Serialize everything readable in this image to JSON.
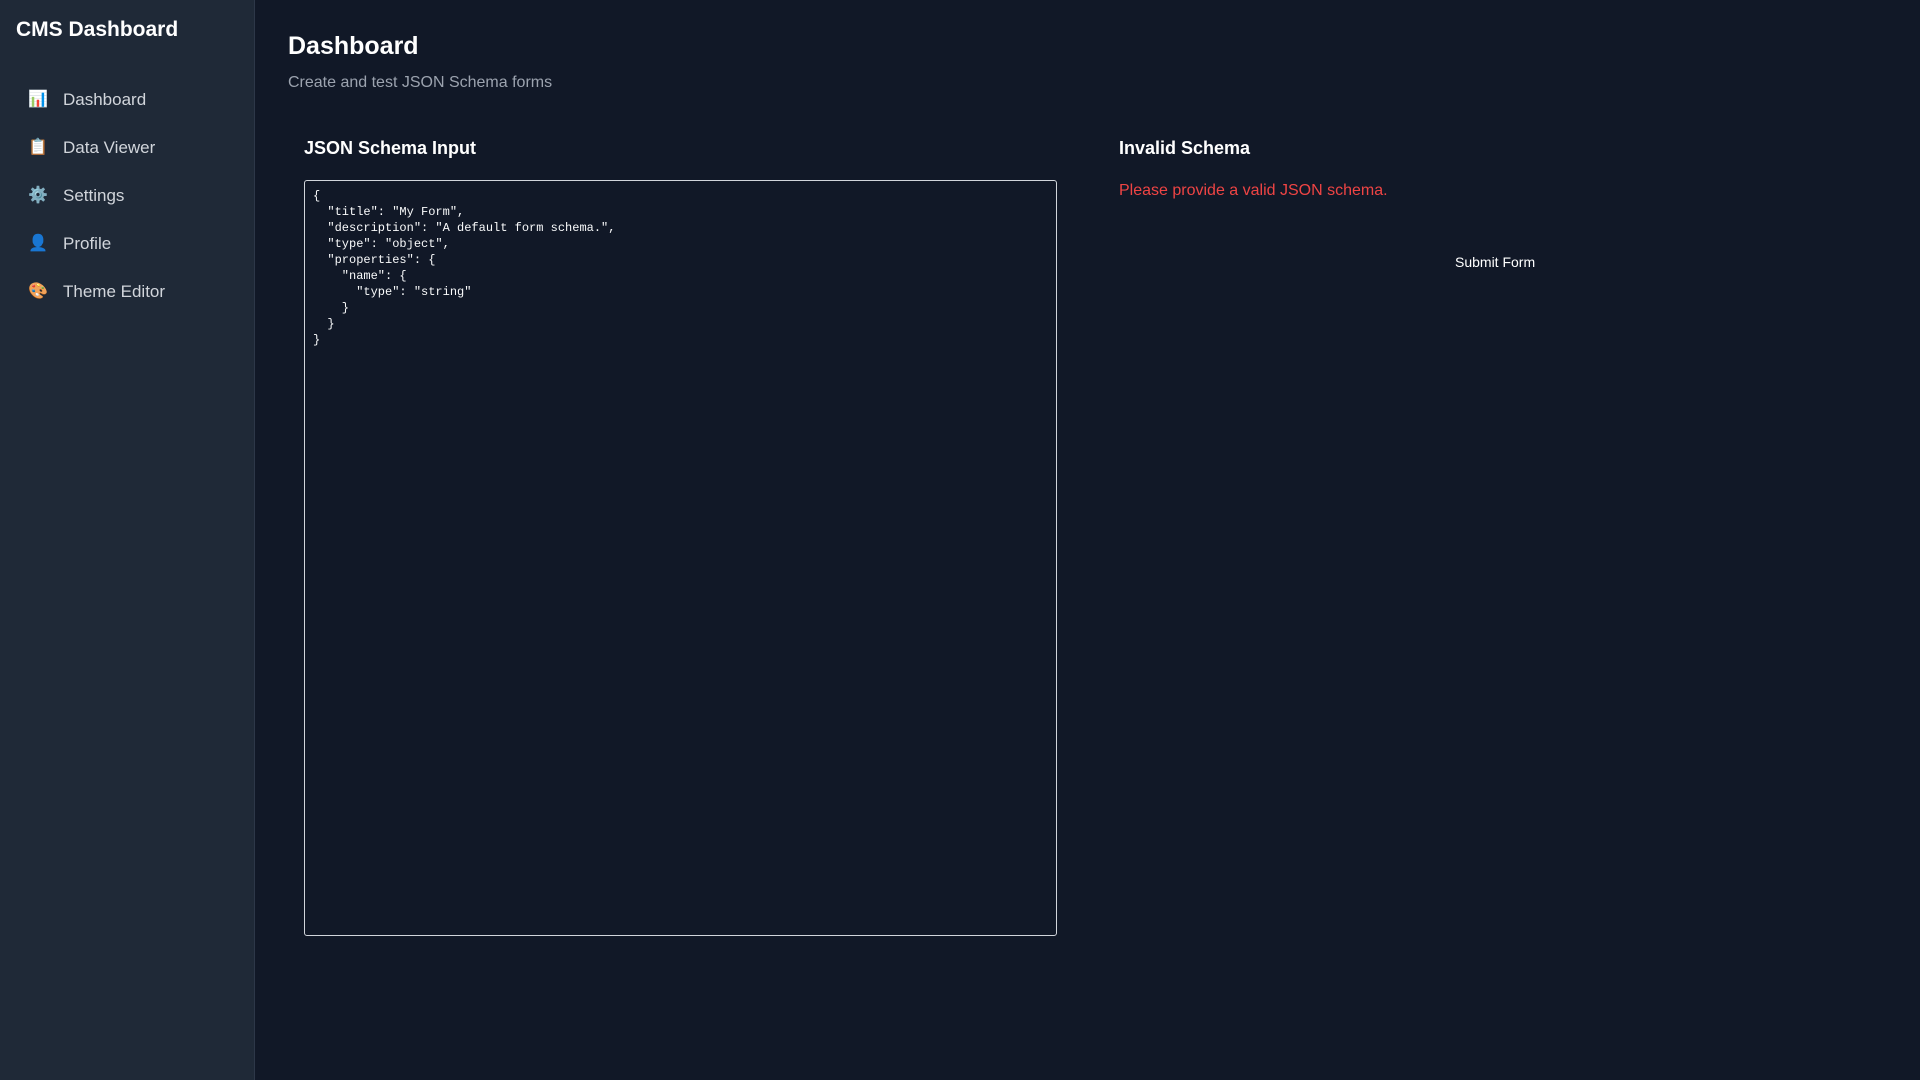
{
  "sidebar": {
    "brand": "CMS Dashboard",
    "items": [
      {
        "label": "Dashboard",
        "icon": "chart-icon",
        "glyph": "📊"
      },
      {
        "label": "Data Viewer",
        "icon": "clipboard-icon",
        "glyph": "📋"
      },
      {
        "label": "Settings",
        "icon": "gear-icon",
        "glyph": "⚙️"
      },
      {
        "label": "Profile",
        "icon": "user-icon",
        "glyph": "👤"
      },
      {
        "label": "Theme Editor",
        "icon": "palette-icon",
        "glyph": "🎨"
      }
    ]
  },
  "header": {
    "title": "Dashboard",
    "subtitle": "Create and test JSON Schema forms"
  },
  "schema_panel": {
    "heading": "JSON Schema Input",
    "value": "{\n  \"title\": \"My Form\",\n  \"description\": \"A default form schema.\",\n  \"type\": \"object\",\n  \"properties\": {\n    \"name\": {\n      \"type\": \"string\"\n    }\n  }\n}"
  },
  "preview_panel": {
    "heading": "Invalid Schema",
    "error": "Please provide a valid JSON schema.",
    "submit_label": "Submit Form"
  },
  "colors": {
    "background": "#111827",
    "sidebar": "#1f2937",
    "error": "#ef4444",
    "text_muted": "#9ca3af"
  }
}
